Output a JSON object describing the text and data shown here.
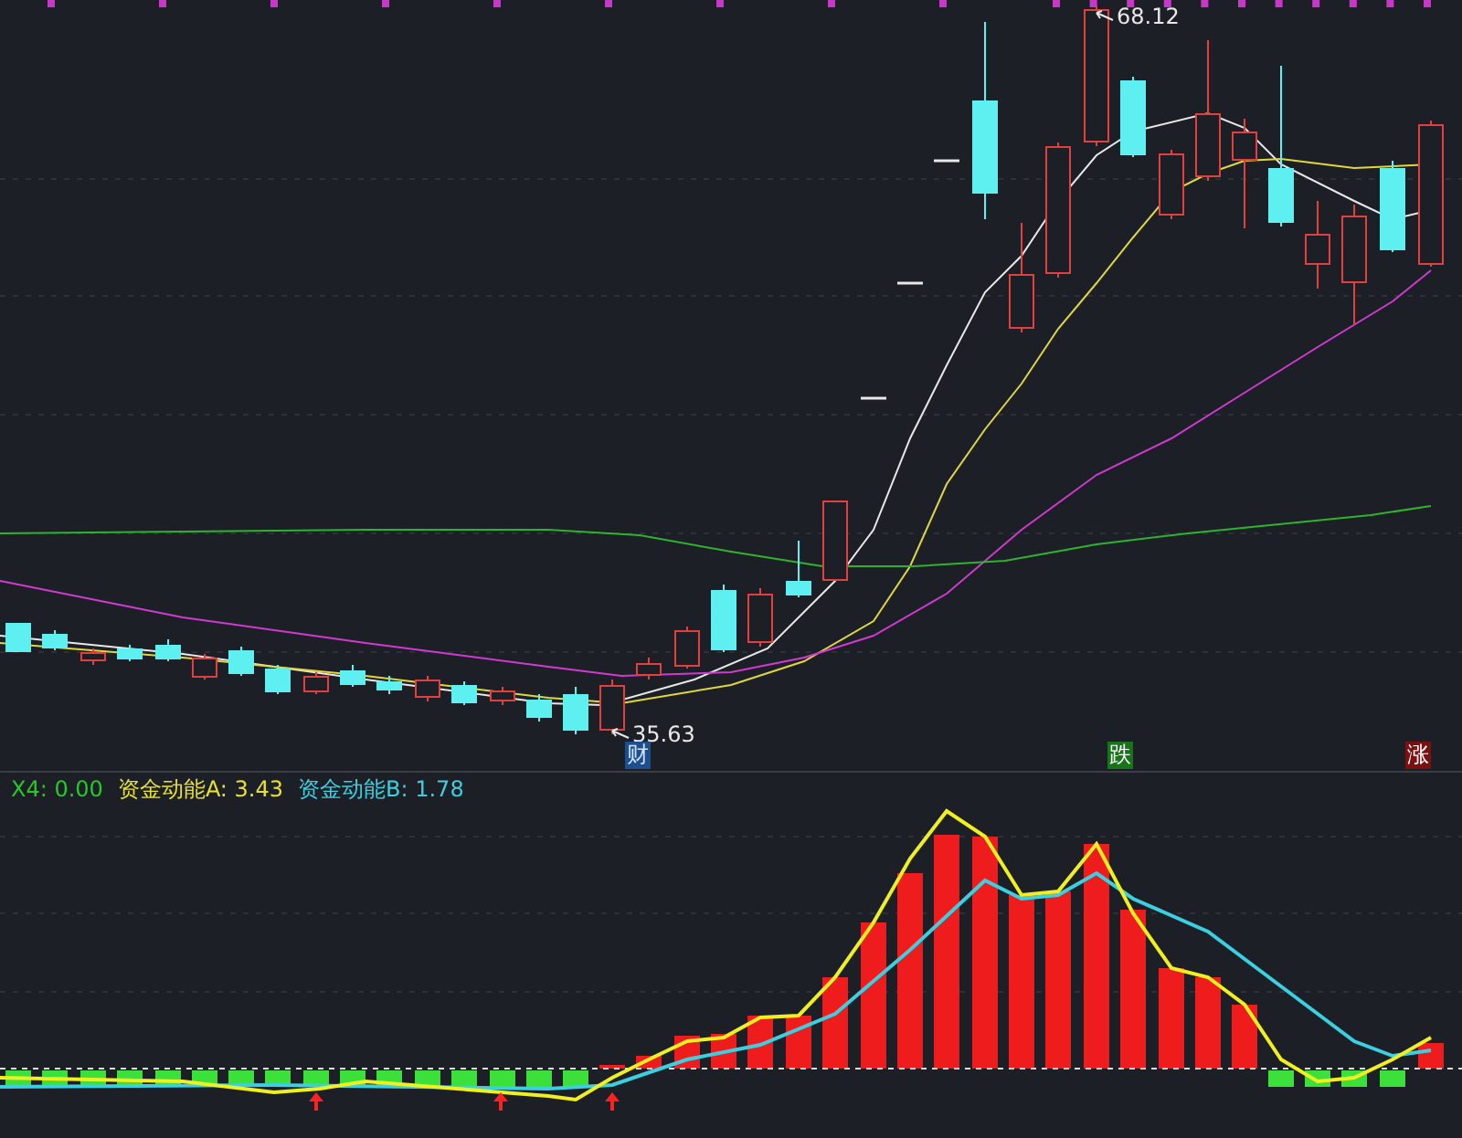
{
  "price_panel": {
    "high_label": "68.12",
    "low_label": "35.63",
    "event_tags": [
      {
        "text": "财",
        "kind": "finance"
      },
      {
        "text": "跌",
        "kind": "down"
      },
      {
        "text": "涨",
        "kind": "up"
      }
    ]
  },
  "indicator_panel": {
    "legend": [
      {
        "text": "X4: 0.00",
        "color": "#22cc22"
      },
      {
        "text": "资金动能A: 3.43",
        "color": "#e6e032"
      },
      {
        "text": "资金动能B: 1.78",
        "color": "#3ccfe0"
      }
    ]
  }
}
